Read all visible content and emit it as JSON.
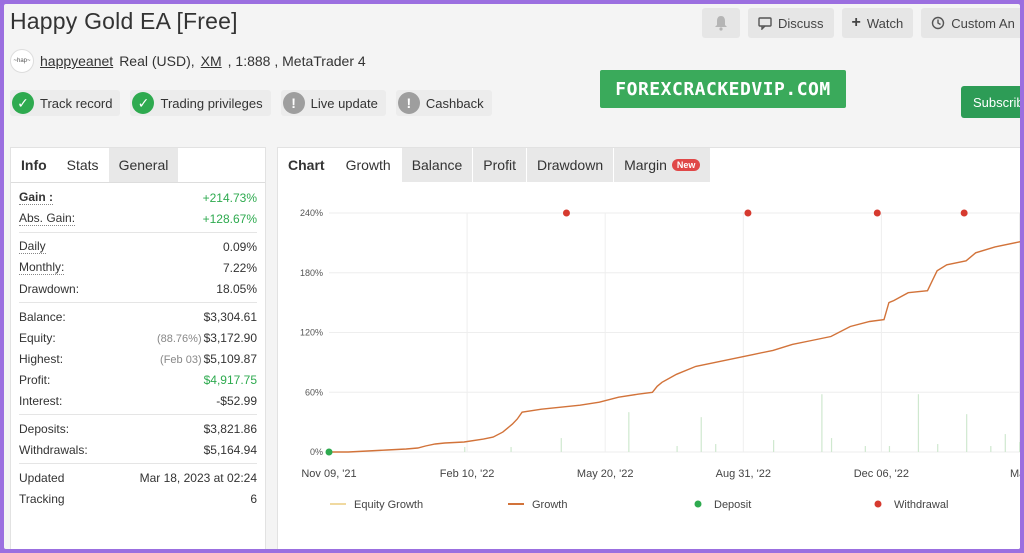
{
  "header": {
    "title": "Happy Gold EA [Free]",
    "avatar_text": "~hap~",
    "username": "happyeanet",
    "account_type": "Real (USD),",
    "broker": "XM",
    "leverage": ", 1:888 , MetaTrader 4"
  },
  "badges": [
    {
      "label": "Track record",
      "status": "ok"
    },
    {
      "label": "Trading privileges",
      "status": "ok"
    },
    {
      "label": "Live update",
      "status": "warn"
    },
    {
      "label": "Cashback",
      "status": "warn"
    }
  ],
  "actions": {
    "bell_icon": "bell-icon",
    "discuss": "Discuss",
    "watch": "Watch",
    "custom": "Custom An",
    "subscribe": "Subscrib"
  },
  "watermark": "FOREXCRACKEDVIP.COM",
  "left_tabs": [
    "Info",
    "Stats",
    "General"
  ],
  "stats": {
    "gain": {
      "label": "Gain :",
      "value": "+214.73%"
    },
    "abs_gain": {
      "label": "Abs. Gain:",
      "value": "+128.67%"
    },
    "daily": {
      "label": "Daily",
      "value": "0.09%"
    },
    "monthly": {
      "label": "Monthly:",
      "value": "7.22%"
    },
    "drawdown": {
      "label": "Drawdown:",
      "value": "18.05%"
    },
    "balance": {
      "label": "Balance:",
      "value": "$3,304.61"
    },
    "equity": {
      "label": "Equity:",
      "sub": "(88.76%)",
      "value": "$3,172.90"
    },
    "highest": {
      "label": "Highest:",
      "sub": "(Feb 03)",
      "value": "$5,109.87"
    },
    "profit": {
      "label": "Profit:",
      "value": "$4,917.75"
    },
    "interest": {
      "label": "Interest:",
      "value": "-$52.99"
    },
    "deposits": {
      "label": "Deposits:",
      "value": "$3,821.86"
    },
    "withdrawals": {
      "label": "Withdrawals:",
      "value": "$5,164.94"
    },
    "updated": {
      "label": "Updated",
      "value": "Mar 18, 2023 at 02:24"
    },
    "tracking": {
      "label": "Tracking",
      "value": "6"
    }
  },
  "chart_tabs": [
    "Chart",
    "Growth",
    "Balance",
    "Profit",
    "Drawdown",
    "Margin"
  ],
  "margin_badge": "New",
  "colors": {
    "growth": "#d2733a",
    "equity": "#f0d9a0",
    "deposit": "#2eaa4f",
    "withdrawal": "#d63a2f",
    "bars": "#cfe8cf"
  },
  "chart_data": {
    "type": "line",
    "y_ticks": [
      "0%",
      "60%",
      "120%",
      "180%",
      "240%"
    ],
    "ylim": [
      0,
      240
    ],
    "x_ticks": [
      "Nov 09, '21",
      "Feb 10, '22",
      "May 20, '22",
      "Aug 31, '22",
      "Dec 06, '22",
      "Mar"
    ],
    "legend": [
      "Equity Growth",
      "Growth",
      "Deposit",
      "Withdrawal"
    ],
    "series": [
      {
        "name": "Growth",
        "x": [
          0,
          20,
          40,
          60,
          80,
          92,
          100,
          110,
          120,
          140,
          160,
          170,
          180,
          190,
          195,
          200,
          220,
          240,
          260,
          280,
          300,
          320,
          335,
          340,
          345,
          360,
          380,
          400,
          420,
          440,
          460,
          480,
          500,
          520,
          540,
          560,
          575,
          580,
          585,
          600,
          620,
          625,
          630,
          640,
          660,
          665,
          670,
          690,
          720
        ],
        "y": [
          0,
          0,
          1,
          2,
          3,
          4,
          6,
          8,
          9,
          10,
          13,
          15,
          20,
          28,
          33,
          40,
          43,
          45,
          47,
          50,
          55,
          58,
          60,
          66,
          70,
          78,
          86,
          90,
          94,
          98,
          102,
          108,
          112,
          116,
          126,
          131,
          133,
          150,
          152,
          160,
          162,
          172,
          182,
          188,
          192,
          196,
          200,
          206,
          212
        ]
      }
    ],
    "deposits": [
      {
        "x": 0,
        "y": 0
      }
    ],
    "withdrawals_markers": [
      {
        "x": 246
      },
      {
        "x": 434
      },
      {
        "x": 568
      },
      {
        "x": 658
      }
    ]
  }
}
